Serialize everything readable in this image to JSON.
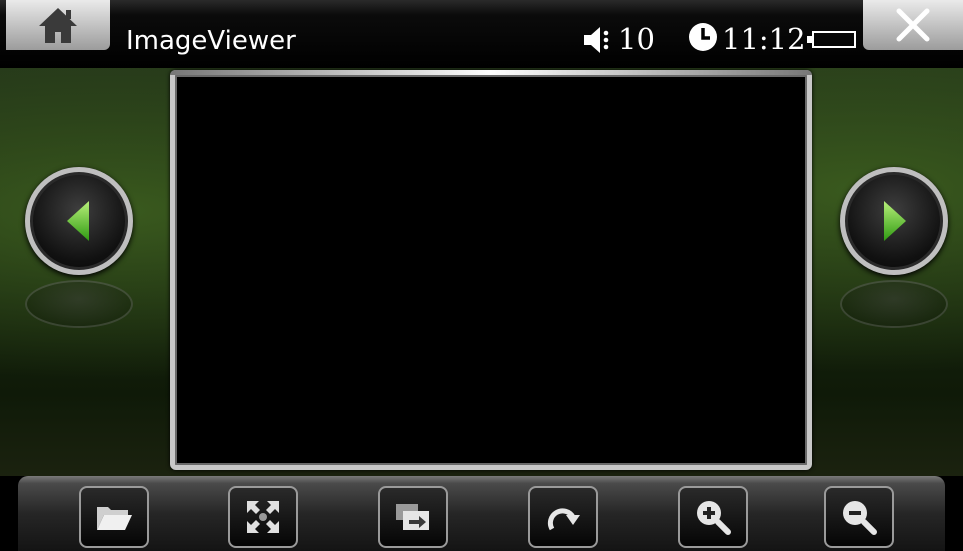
{
  "app": {
    "title": "ImageViewer"
  },
  "status": {
    "volume": "10",
    "time": "11:12",
    "volume_icon": "speaker-icon",
    "clock_icon": "clock-icon",
    "battery_icon": "battery-icon"
  },
  "topbar": {
    "home_icon": "home-icon",
    "close_icon": "close-icon"
  },
  "navigation": {
    "prev_icon": "arrow-left-icon",
    "next_icon": "arrow-right-icon",
    "arrow_color": "#5fcf2a"
  },
  "toolbar": {
    "buttons": [
      {
        "icon": "open-folder-icon"
      },
      {
        "icon": "fullscreen-icon"
      },
      {
        "icon": "slideshow-icon"
      },
      {
        "icon": "rotate-icon"
      },
      {
        "icon": "zoom-in-icon"
      },
      {
        "icon": "zoom-out-icon"
      }
    ]
  }
}
